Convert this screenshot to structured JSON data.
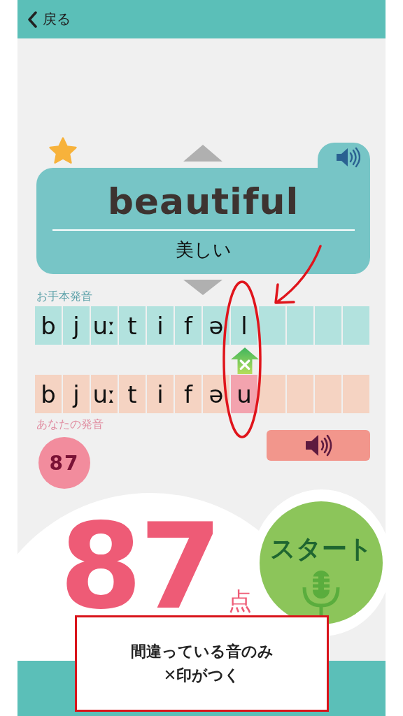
{
  "header": {
    "back_label": "戻る"
  },
  "word_card": {
    "favorite": true,
    "word": "beautiful",
    "meaning": "美しい"
  },
  "model": {
    "label": "お手本発音",
    "phonemes": [
      {
        "symbol": "b"
      },
      {
        "symbol": "j"
      },
      {
        "symbol": "uː"
      },
      {
        "symbol": "t"
      },
      {
        "symbol": "i"
      },
      {
        "symbol": "f"
      },
      {
        "symbol": "ə"
      },
      {
        "symbol": "l"
      }
    ]
  },
  "user": {
    "label": "あなたの発音",
    "phonemes": [
      {
        "symbol": "b",
        "wrong": false
      },
      {
        "symbol": "j",
        "wrong": false
      },
      {
        "symbol": "uː",
        "wrong": false
      },
      {
        "symbol": "t",
        "wrong": false
      },
      {
        "symbol": "i",
        "wrong": false
      },
      {
        "symbol": "f",
        "wrong": false
      },
      {
        "symbol": "ə",
        "wrong": false
      },
      {
        "symbol": "u",
        "wrong": true
      }
    ]
  },
  "score_badge": "87",
  "score": {
    "value": "87",
    "unit": "点"
  },
  "start_button": "スタート",
  "callout": {
    "lines": [
      "間違っている音のみ",
      "✕印がつく"
    ]
  }
}
